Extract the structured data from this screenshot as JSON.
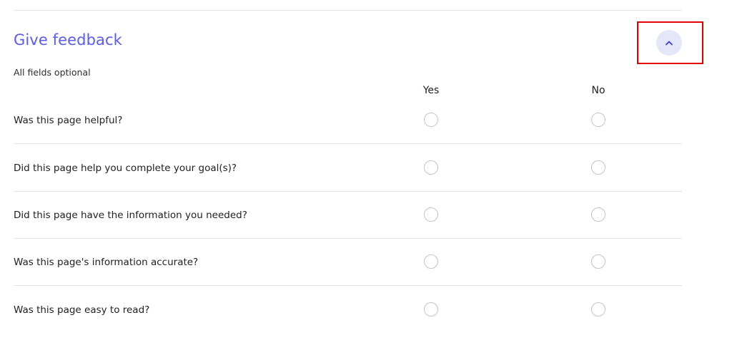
{
  "feedback": {
    "title": "Give feedback",
    "subtitle": "All fields optional",
    "collapse_icon": "chevron-up-icon",
    "accent_color": "#5b5bf0",
    "columns": {
      "yes": "Yes",
      "no": "No"
    },
    "questions": [
      {
        "label": "Was this page helpful?"
      },
      {
        "label": "Did this page help you complete your goal(s)?"
      },
      {
        "label": "Did this page have the information you needed?"
      },
      {
        "label": "Was this page's information accurate?"
      },
      {
        "label": "Was this page easy to read?"
      }
    ]
  }
}
